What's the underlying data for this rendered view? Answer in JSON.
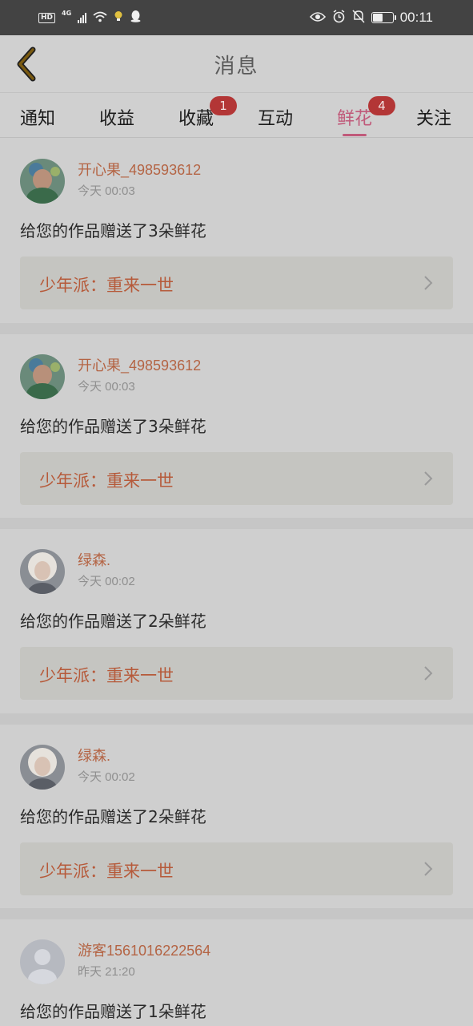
{
  "status_bar": {
    "hd": "HD",
    "net": "4G",
    "time": "00:11",
    "battery_pct": 0.5
  },
  "header": {
    "title": "消息",
    "back_icon": "chevron-left-icon",
    "back_color": "#7a5a10"
  },
  "tabs": [
    {
      "label": "通知",
      "badge": null,
      "active": false
    },
    {
      "label": "收益",
      "badge": null,
      "active": false
    },
    {
      "label": "收藏",
      "badge": "1",
      "active": false
    },
    {
      "label": "互动",
      "badge": null,
      "active": false
    },
    {
      "label": "鲜花",
      "badge": "4",
      "active": true
    },
    {
      "label": "关注",
      "badge": null,
      "active": false
    }
  ],
  "colors": {
    "accent": "#c05a7a",
    "username": "#b46444",
    "badge": "#b33636",
    "work_title": "#b65a3a"
  },
  "messages": [
    {
      "user": "开心果_498593612",
      "time": "今天 00:03",
      "text": "给您的作品赠送了3朵鲜花",
      "work": "少年派：重来一世",
      "avatar": "child-photo"
    },
    {
      "user": "开心果_498593612",
      "time": "今天 00:03",
      "text": "给您的作品赠送了3朵鲜花",
      "work": "少年派：重来一世",
      "avatar": "child-photo"
    },
    {
      "user": "绿森.",
      "time": "今天 00:02",
      "text": "给您的作品赠送了2朵鲜花",
      "work": "少年派：重来一世",
      "avatar": "girl-photo"
    },
    {
      "user": "绿森.",
      "time": "今天 00:02",
      "text": "给您的作品赠送了2朵鲜花",
      "work": "少年派：重来一世",
      "avatar": "girl-photo"
    },
    {
      "user": "游客1561016222564",
      "time": "昨天 21:20",
      "text": "给您的作品赠送了1朵鲜花",
      "work": "",
      "avatar": "default-user"
    }
  ]
}
